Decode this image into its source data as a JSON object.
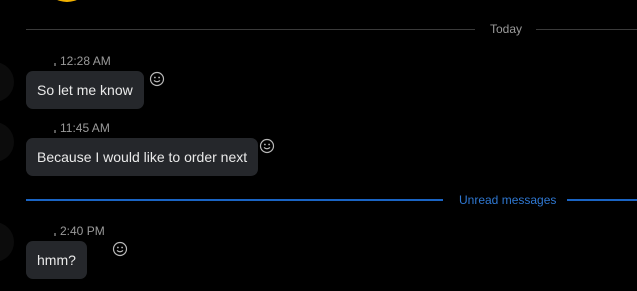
{
  "dividers": {
    "today_label": "Today",
    "unread_label": "Unread messages"
  },
  "messages": [
    {
      "time": "12:28 AM",
      "text": "So let me know"
    },
    {
      "time": "11:45 AM",
      "text": "Because I would like to order next"
    },
    {
      "time": "2:40 PM",
      "text": "hmm?"
    }
  ],
  "icons": {
    "reaction": "smiley-face-icon"
  },
  "colors": {
    "background": "#000000",
    "bubble": "#25272b",
    "unread_accent": "#1a64c4",
    "emoji_partial": "#f3b200"
  }
}
